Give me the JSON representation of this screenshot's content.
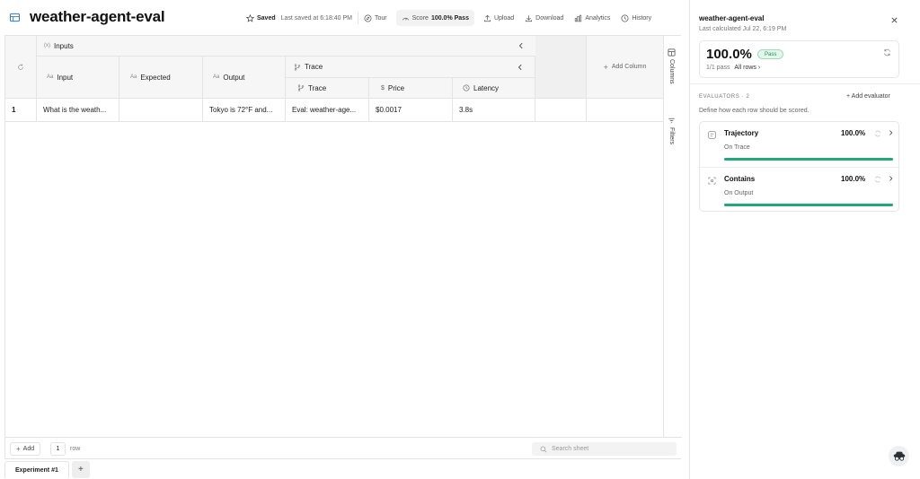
{
  "app": {
    "title": "weather-agent-eval",
    "icon": "sheet-icon"
  },
  "toolbar": {
    "saved_label": "Saved",
    "saved_sub": "Last saved at 6:18:40 PM",
    "tour": "Tour",
    "score_label": "Score",
    "score_value": "100.0% Pass",
    "upload": "Upload",
    "download": "Download",
    "analytics": "Analytics",
    "history": "History"
  },
  "grid": {
    "group_inputs": "Inputs",
    "group_trace": "Trace",
    "type_text": "Aa",
    "columns": {
      "input": "Input",
      "expected": "Expected",
      "output": "Output",
      "trace": "Trace",
      "price": "Price",
      "latency": "Latency"
    },
    "add_column": "Add Column",
    "rows": [
      {
        "index": "1",
        "input": "What is the weath...",
        "expected": "",
        "output": "Tokyo is 72°F and...",
        "trace": "Eval: weather-age...",
        "price": "$0.0017",
        "latency": "3.8s"
      }
    ]
  },
  "side_tabs": {
    "columns": "Columns",
    "filters": "Filters"
  },
  "footer": {
    "add": "Add",
    "row_count": "1",
    "row_label": "row",
    "search_placeholder": "Search sheet"
  },
  "tabs": [
    {
      "label": "Experiment #1"
    }
  ],
  "tab_add": "+",
  "panel": {
    "title": "weather-agent-eval",
    "subtitle": "Last calculated Jul 22, 6:19 PM",
    "score": "100.0%",
    "badge": "Pass",
    "pass_line": "1/1 pass",
    "rows_filter": "All rows ›",
    "evaluators_header": "EVALUATORS · 2",
    "add_evaluator": "+ Add evaluator",
    "description": "Define how each row should be scored.",
    "evaluators": [
      {
        "name": "Trajectory",
        "pct": "100.0%",
        "on": "On Trace",
        "fill": 1.0
      },
      {
        "name": "Contains",
        "pct": "100.0%",
        "on": "On Output",
        "fill": 1.0
      }
    ]
  },
  "colors": {
    "accent_green": "#1fa87a",
    "pass_bg": "#e3f6ec",
    "pass_text": "#1f8a55"
  }
}
